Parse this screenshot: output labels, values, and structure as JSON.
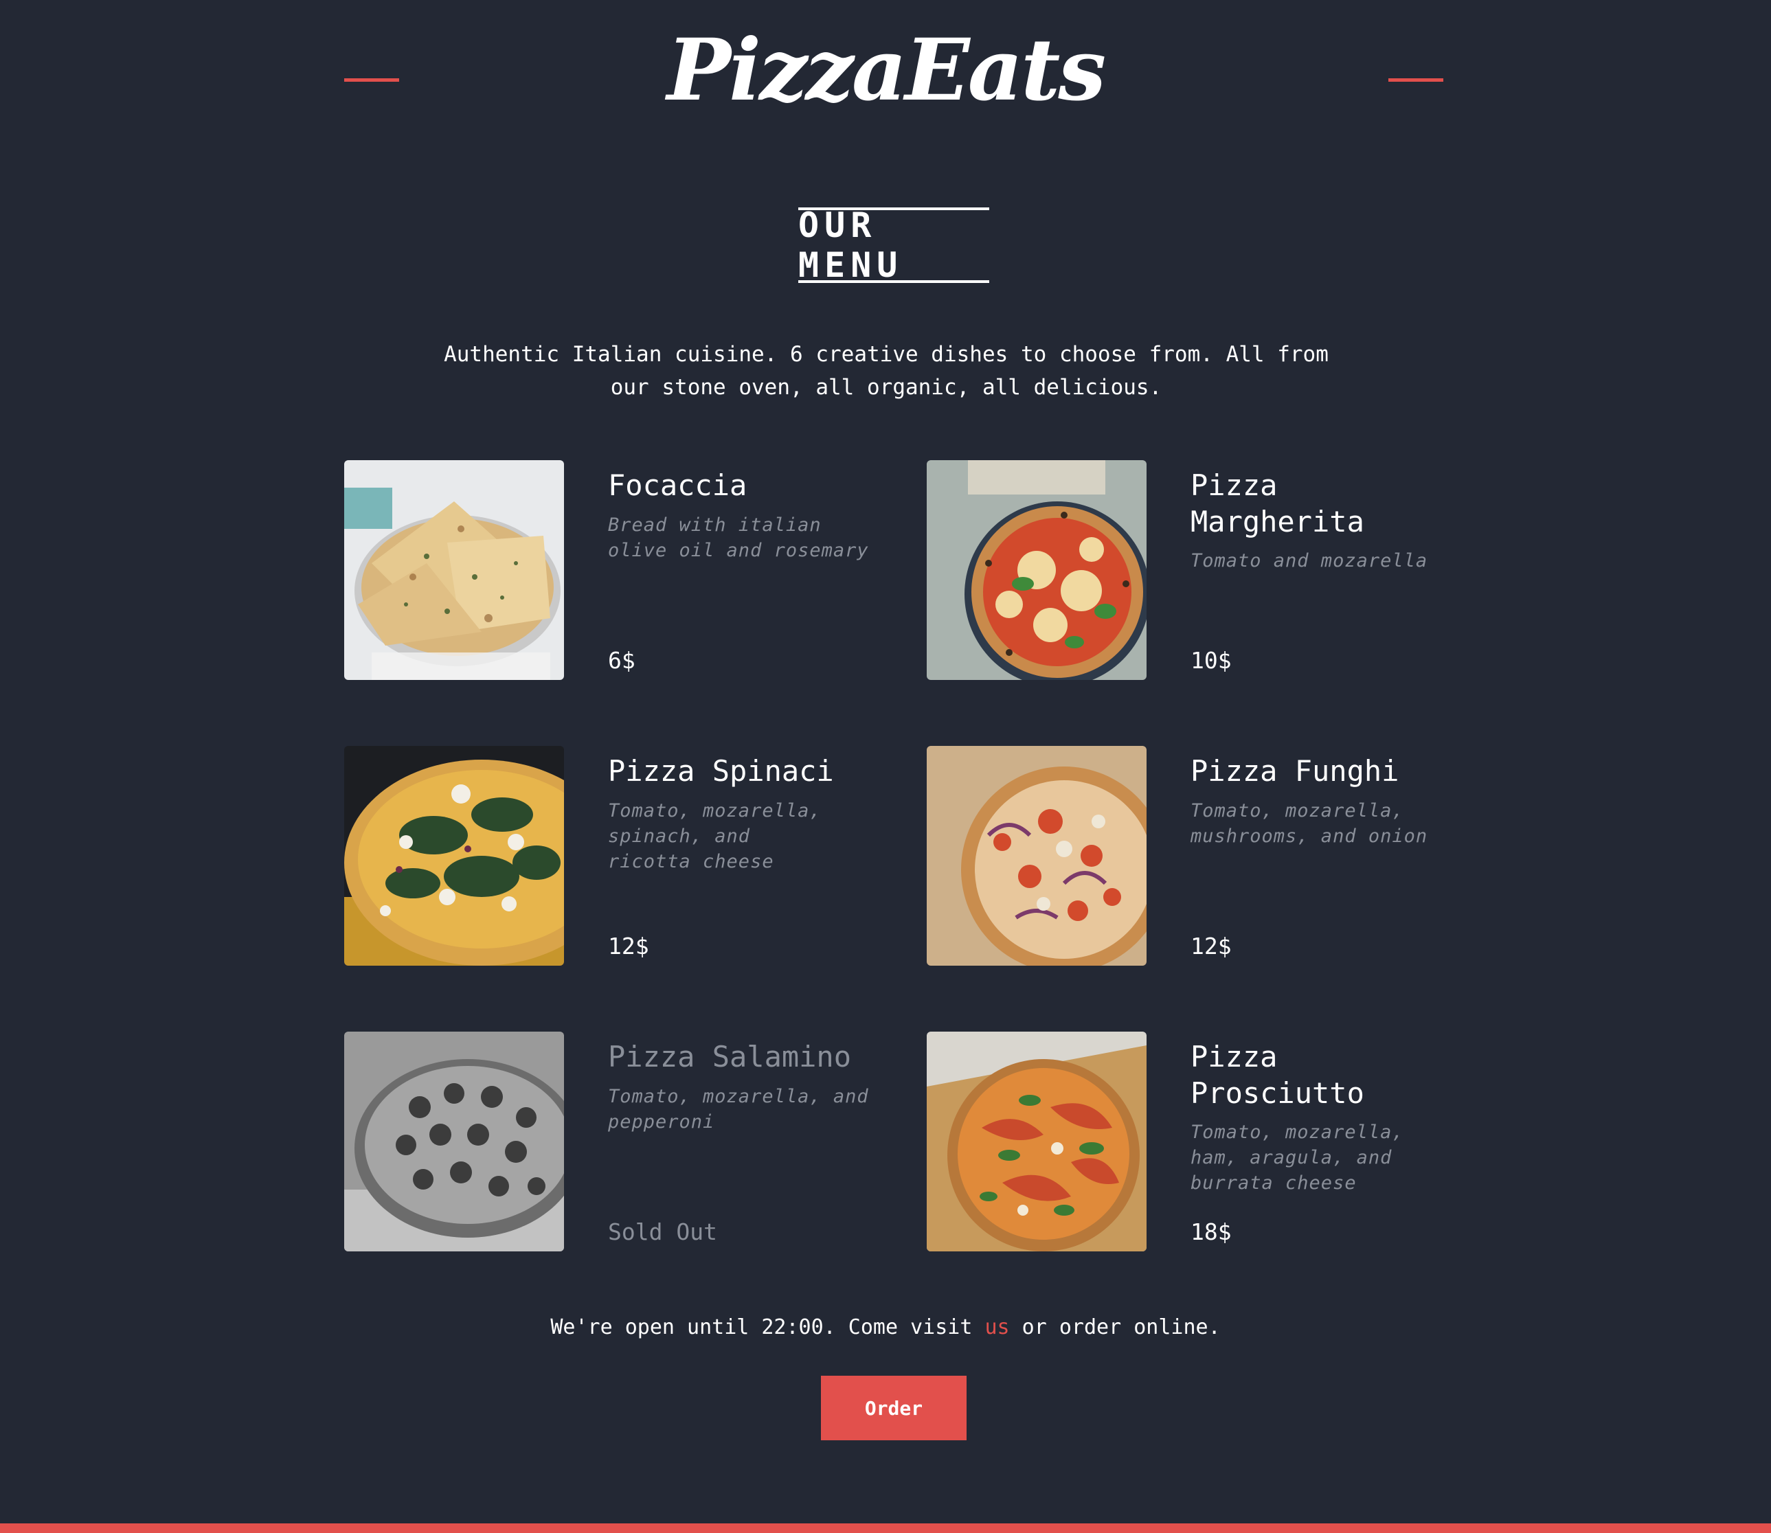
{
  "header": {
    "logo": "PizzaEats",
    "accent_color": "#e2504c"
  },
  "menu_section": {
    "title": "OUR MENU",
    "intro": "Authentic Italian cuisine. 6 creative dishes to choose from. All from our stone oven, all organic, all delicious."
  },
  "menu_items": [
    {
      "name": "Focaccia",
      "description": "Bread with italian olive oil and rosemary",
      "price": "6$",
      "image_icon": "focaccia-bread-image"
    },
    {
      "name": "Pizza Margherita",
      "description": "Tomato and mozarella",
      "price": "10$",
      "image_icon": "pizza-margherita-image"
    },
    {
      "name": "Pizza Spinaci",
      "description": "Tomato, mozarella, spinach, and ricotta cheese",
      "price": "12$",
      "image_icon": "pizza-spinaci-image"
    },
    {
      "name": "Pizza Funghi",
      "description": "Tomato, mozarella, mushrooms, and onion",
      "price": "12$",
      "image_icon": "pizza-funghi-image"
    },
    {
      "name": "Pizza Salamino",
      "description": "Tomato, mozarella, and pepperoni",
      "price": "Sold Out",
      "image_icon": "pizza-salamino-image"
    },
    {
      "name": "Pizza Prosciutto",
      "description": "Tomato, mozarella, ham, aragula, and burrata cheese",
      "price": "18$",
      "image_icon": "pizza-prosciutto-image"
    }
  ],
  "footer": {
    "text_before": "We're open until 22:00. Come visit ",
    "link_text": "us",
    "text_after": " or order online.",
    "order_button": "Order"
  }
}
